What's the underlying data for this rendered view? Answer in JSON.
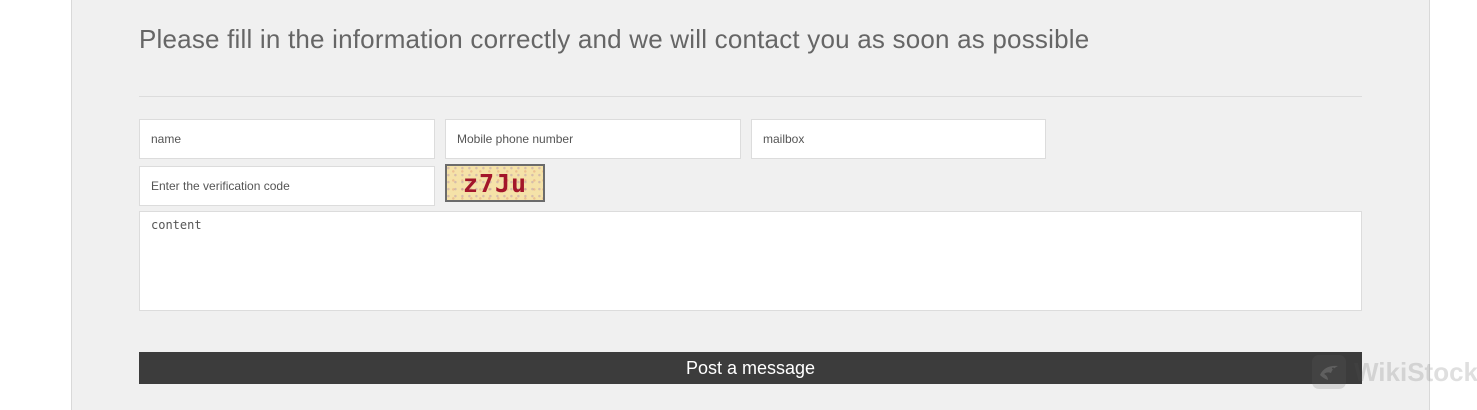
{
  "form": {
    "heading": "Please fill in the information correctly and we will contact you as soon as possible",
    "name_placeholder": "name",
    "phone_placeholder": "Mobile phone number",
    "mailbox_placeholder": "mailbox",
    "verification_placeholder": "Enter the verification code",
    "captcha_text": "z7Ju",
    "content_placeholder": "content",
    "submit_label": "Post a message"
  },
  "watermark": {
    "text": "WikiStock",
    "icon": "eagle-logo-icon"
  },
  "colors": {
    "panel_background": "#f0f0f0",
    "button_background": "#3c3c3c",
    "heading_text": "#666666",
    "captcha_background": "#f5e2a8",
    "captcha_text": "#a3162a"
  }
}
